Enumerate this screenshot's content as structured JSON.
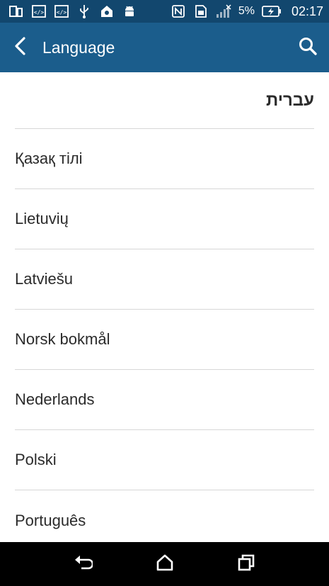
{
  "status_bar": {
    "battery_percent": "5%",
    "time": "02:17",
    "icons": [
      "phone-tablet-icon",
      "code-icon",
      "code-icon",
      "usb-icon",
      "home-icon",
      "android-icon",
      "nfc-icon",
      "sim-icon",
      "signal-icon",
      "battery-charging-icon"
    ]
  },
  "toolbar": {
    "title": "Language",
    "back_icon": "chevron-left-icon",
    "search_icon": "search-icon"
  },
  "languages": [
    {
      "label": "עברית"
    },
    {
      "label": "Қазақ тілі"
    },
    {
      "label": "Lietuvių"
    },
    {
      "label": "Latviešu"
    },
    {
      "label": "Norsk bokmål"
    },
    {
      "label": "Nederlands"
    },
    {
      "label": "Polski"
    },
    {
      "label": "Português"
    }
  ],
  "nav_bar": {
    "icons": [
      "back-icon",
      "home-icon",
      "recents-icon"
    ]
  },
  "colors": {
    "status_bar": "#12476e",
    "toolbar": "#1b5d8c",
    "divider": "#d7d7d7",
    "text": "#2b2b2b"
  }
}
